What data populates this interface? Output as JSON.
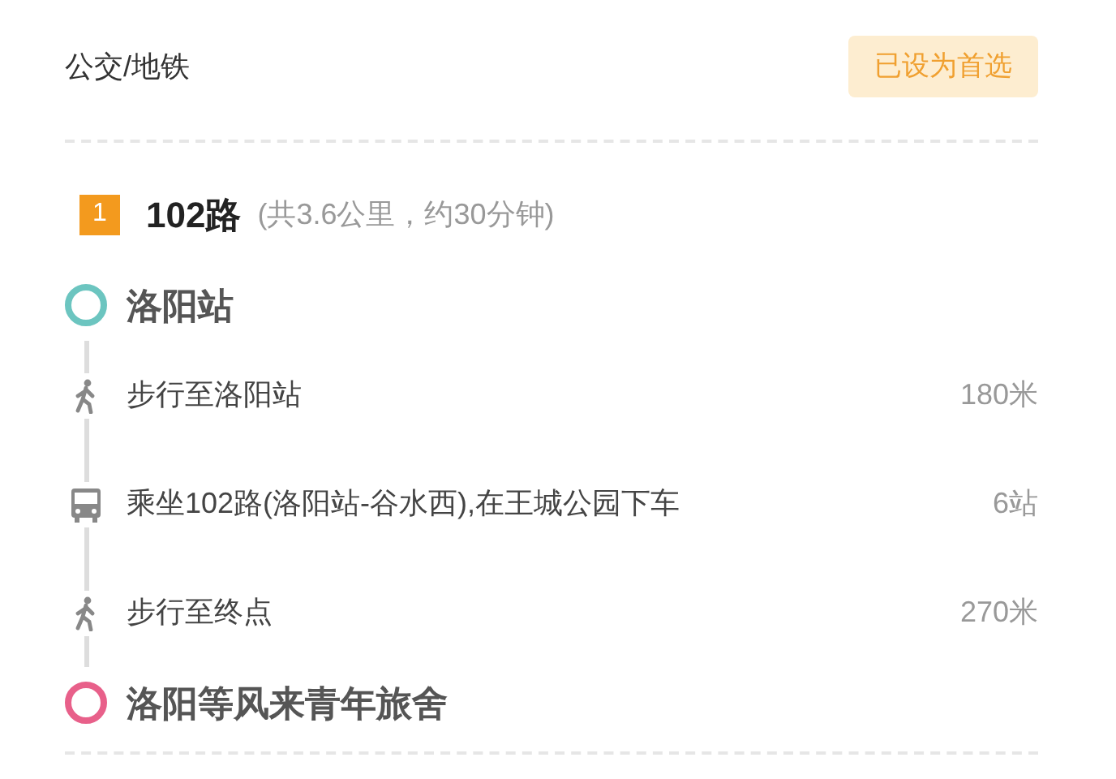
{
  "header": {
    "title": "公交/地铁",
    "preferred_badge": "已设为首选"
  },
  "route": {
    "index": "1",
    "name": "102路",
    "summary": "(共3.6公里，约30分钟)"
  },
  "start": {
    "name": "洛阳站",
    "color": "#6cc5c0"
  },
  "steps": [
    {
      "kind": "walk",
      "text": "步行至洛阳站",
      "distance": "180米"
    },
    {
      "kind": "bus",
      "text": "乘坐102路(洛阳站-谷水西),在王城公园下车",
      "distance": "6站"
    },
    {
      "kind": "walk",
      "text": "步行至终点",
      "distance": "270米"
    }
  ],
  "end": {
    "name": "洛阳等风来青年旅舍",
    "color": "#e8608a"
  }
}
